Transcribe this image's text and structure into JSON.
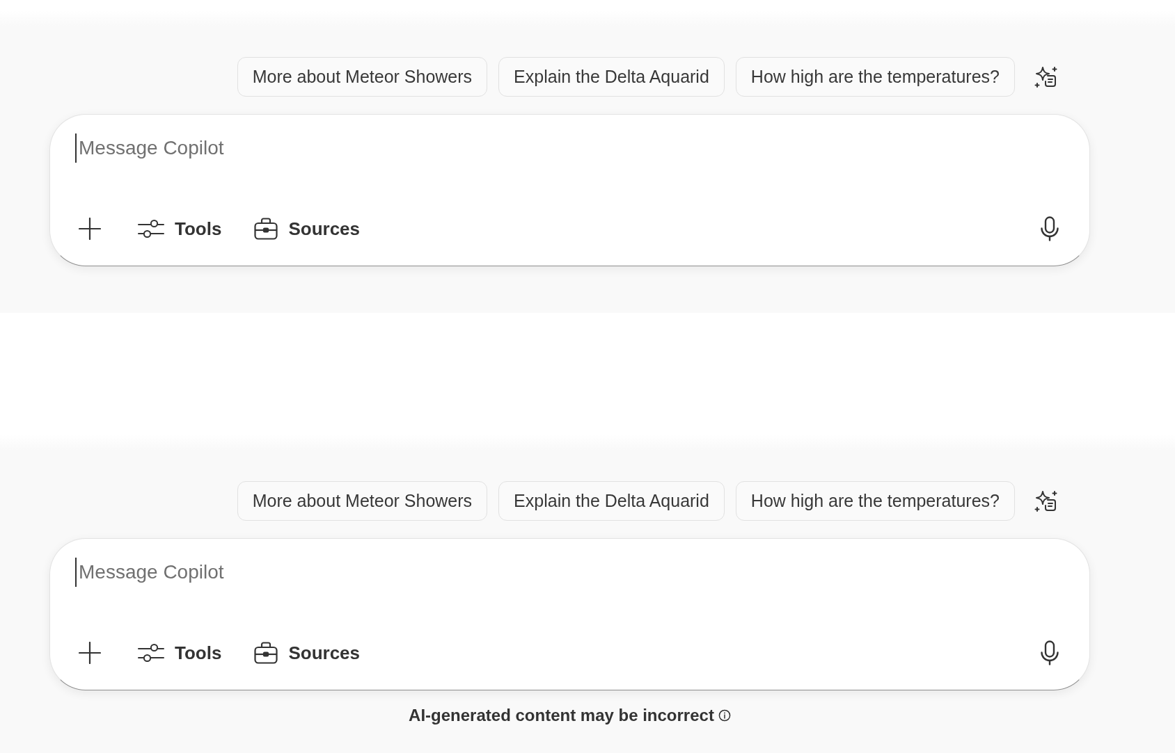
{
  "panels": [
    {
      "suggestions": [
        "More about Meteor Showers",
        "Explain the Delta Aquarid",
        "How high are the temperatures?"
      ],
      "composer": {
        "placeholder": "Message Copilot",
        "focused": true,
        "buttons": [
          {
            "kind": "tools",
            "label": "Tools"
          },
          {
            "kind": "sources",
            "label": "Sources"
          }
        ]
      }
    },
    {
      "suggestions": [
        "More about Meteor Showers",
        "Explain the Delta Aquarid",
        "How high are the temperatures?"
      ],
      "composer": {
        "placeholder": "Message Copilot",
        "focused": true,
        "buttons": [
          {
            "kind": "tools",
            "label": "Tools"
          },
          {
            "kind": "sources",
            "label": "Sources"
          }
        ]
      },
      "disclaimer": "AI-generated content may be incorrect"
    }
  ]
}
